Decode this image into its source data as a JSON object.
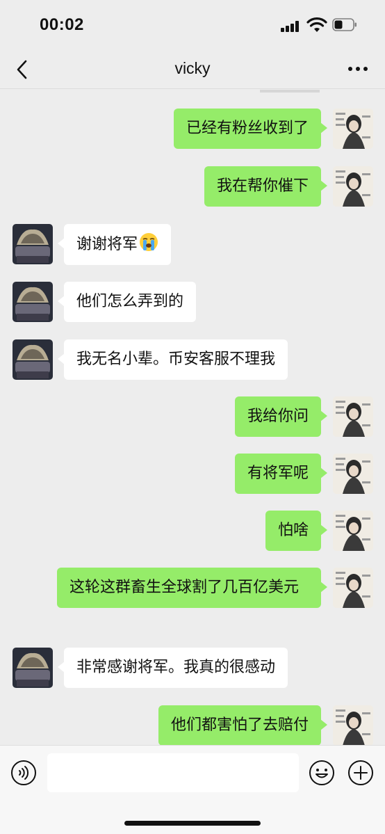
{
  "status_bar": {
    "time": "00:02",
    "icons": [
      "cellular-signal-icon",
      "wifi-icon",
      "battery-icon"
    ]
  },
  "nav": {
    "title": "vicky",
    "back_icon": "chevron-left-icon",
    "more_icon": "ellipsis-icon"
  },
  "colors": {
    "background": "#ededed",
    "outgoing_bubble": "#95ec69",
    "incoming_bubble": "#ffffff",
    "input_bar": "#f7f7f7"
  },
  "messages": [
    {
      "side": "right",
      "text": "已经有粉丝收到了"
    },
    {
      "side": "right",
      "text": "我在帮你催下"
    },
    {
      "side": "left",
      "text": "谢谢将军",
      "emoji": "loudly-crying-face-emoji"
    },
    {
      "side": "left",
      "text": "他们怎么弄到的"
    },
    {
      "side": "left",
      "text": "我无名小辈。币安客服不理我"
    },
    {
      "side": "right",
      "text": "我给你问"
    },
    {
      "side": "right",
      "text": "有将军呢"
    },
    {
      "side": "right",
      "text": "怕啥"
    },
    {
      "side": "right",
      "text": "这轮这群畜生全球割了几百亿美元"
    },
    {
      "side": "left",
      "text": "非常感谢将军。我真的很感动"
    },
    {
      "side": "right",
      "text": "他们都害怕了去赔付"
    }
  ],
  "input_bar": {
    "value": "",
    "icons": [
      "voice-icon",
      "emoji-icon",
      "plus-icon"
    ]
  }
}
